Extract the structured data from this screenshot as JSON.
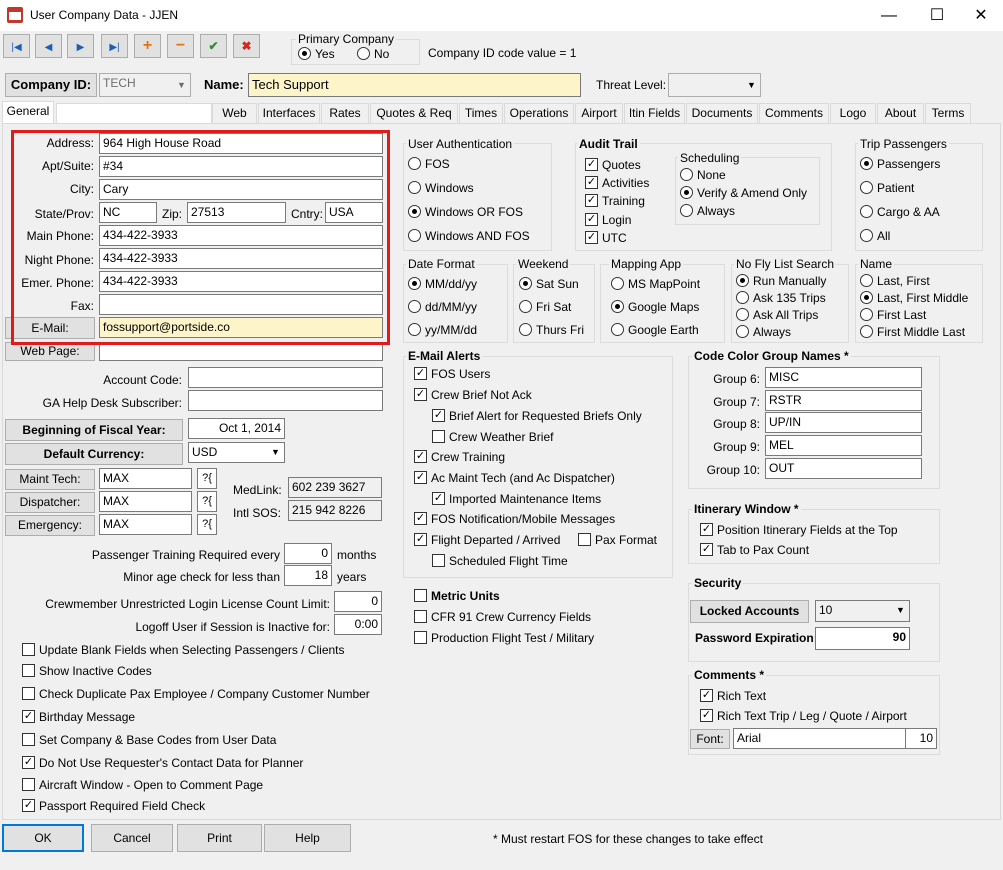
{
  "window": {
    "title": "User Company Data - JJEN",
    "minimize": "—",
    "maximize": "☐",
    "close": "✕"
  },
  "toolbar": {
    "first": "|◀",
    "prev": "◀",
    "next": "▶",
    "last": "▶|",
    "add": "+",
    "remove": "−",
    "confirm": "✔",
    "cancel": "✖"
  },
  "primary_company": {
    "title": "Primary Company",
    "yes": "Yes",
    "no": "No",
    "company_id_note": "Company ID code value = 1"
  },
  "header": {
    "company_id_label": "Company ID:",
    "company_id_value": "TECH",
    "name_label": "Name:",
    "name_value": "Tech Support",
    "threat_label": "Threat Level:",
    "threat_value": ""
  },
  "tabs": [
    "General",
    "",
    "Web",
    "Interfaces",
    "Rates",
    "Quotes & Req",
    "Times",
    "Operations",
    "Airport",
    "Itin Fields",
    "Documents",
    "Comments",
    "Logo",
    "About",
    "Terms"
  ],
  "address": {
    "address_label": "Address:",
    "address_value": "964 High House Road",
    "apt_label": "Apt/Suite:",
    "apt_value": "#34",
    "city_label": "City:",
    "city_value": "Cary",
    "state_label": "State/Prov:",
    "state_value": "NC",
    "zip_label": "Zip:",
    "zip_value": "27513",
    "country_label": "Cntry:",
    "country_value": "USA",
    "main_phone_label": "Main Phone:",
    "main_phone_value": "434-422-3933",
    "night_phone_label": "Night Phone:",
    "night_phone_value": "434-422-3933",
    "emer_phone_label": "Emer. Phone:",
    "emer_phone_value": "434-422-3933",
    "fax_label": "Fax:",
    "fax_value": "",
    "email_button": "E-Mail:",
    "email_value": "fossupport@portside.co",
    "webpage_button": "Web Page:",
    "webpage_value": ""
  },
  "misc": {
    "account_code_label": "Account Code:",
    "account_code_value": "",
    "ga_help_label": "GA Help Desk Subscriber:",
    "ga_help_value": "",
    "fiscal_button": "Beginning of Fiscal Year:",
    "fiscal_value": "Oct 1, 2014",
    "currency_button": "Default Currency:",
    "currency_value": "USD",
    "maint_tech_button": "Maint Tech:",
    "maint_tech_value": "MAX",
    "dispatcher_button": "Dispatcher:",
    "dispatcher_value": "MAX",
    "emergency_button": "Emergency:",
    "emergency_value": "MAX",
    "qm": "?{",
    "medlink_label": "MedLink:",
    "medlink_value": "602 239 3627",
    "intl_sos_label": "Intl SOS:",
    "intl_sos_value": "215 942 8226",
    "pax_training_label": "Passenger Training Required every",
    "pax_training_value": "0",
    "pax_training_unit": "months",
    "minor_age_label": "Minor age check for less than",
    "minor_age_value": "18",
    "minor_age_unit": "years",
    "license_label": "Crewmember Unrestricted Login License Count Limit:",
    "license_value": "0",
    "logoff_label": "Logoff User if Session is Inactive for:",
    "logoff_value": "0:00"
  },
  "left_checks": [
    {
      "label": "Update Blank Fields when Selecting Passengers / Clients",
      "checked": false
    },
    {
      "label": "Show Inactive Codes",
      "checked": false
    },
    {
      "label": "Check Duplicate Pax Employee / Company Customer Number",
      "checked": false
    },
    {
      "label": "Birthday Message",
      "checked": true
    },
    {
      "label": "Set Company & Base Codes from User Data",
      "checked": false
    },
    {
      "label": "Do Not Use Requester's Contact Data for Planner",
      "checked": true
    },
    {
      "label": "Aircraft Window - Open to Comment Page",
      "checked": false
    },
    {
      "label": "Passport Required Field Check",
      "checked": true
    }
  ],
  "user_auth": {
    "title": "User Authentication",
    "options": [
      "FOS",
      "Windows",
      "Windows OR FOS",
      "Windows AND FOS"
    ],
    "selected": 2
  },
  "audit_trail": {
    "title": "Audit Trail",
    "items": [
      {
        "label": "Quotes",
        "checked": true
      },
      {
        "label": "Activities",
        "checked": true
      },
      {
        "label": "Training",
        "checked": true
      },
      {
        "label": "Login",
        "checked": true
      },
      {
        "label": "UTC",
        "checked": true
      }
    ]
  },
  "scheduling": {
    "title": "Scheduling",
    "options": [
      "None",
      "Verify & Amend Only",
      "Always"
    ],
    "selected": 1
  },
  "trip_passengers": {
    "title": "Trip Passengers",
    "options": [
      "Passengers",
      "Patient",
      "Cargo & AA",
      "All"
    ],
    "selected": 0
  },
  "date_format": {
    "title": "Date Format",
    "options": [
      "MM/dd/yy",
      "dd/MM/yy",
      "yy/MM/dd"
    ],
    "selected": 0
  },
  "weekend": {
    "title": "Weekend",
    "options": [
      "Sat Sun",
      "Fri Sat",
      "Thurs Fri"
    ],
    "selected": 0
  },
  "mapping_app": {
    "title": "Mapping App",
    "options": [
      "MS MapPoint",
      "Google Maps",
      "Google Earth"
    ],
    "selected": 1
  },
  "no_fly": {
    "title": "No Fly List Search",
    "options": [
      "Run Manually",
      "Ask 135 Trips",
      "Ask All Trips",
      "Always"
    ],
    "selected": 0
  },
  "name_format": {
    "title": "Name",
    "options": [
      "Last, First",
      "Last, First Middle",
      "First Last",
      "First Middle Last"
    ],
    "selected": 1
  },
  "email_alerts": {
    "title": "E-Mail Alerts",
    "items": [
      {
        "label": "FOS Users",
        "checked": true
      },
      {
        "label": "Crew Brief Not Ack",
        "checked": true
      },
      {
        "label": "Brief Alert for Requested Briefs Only",
        "checked": true
      },
      {
        "label": "Crew Weather Brief",
        "checked": false
      },
      {
        "label": "Crew Training",
        "checked": true
      },
      {
        "label": "Ac Maint Tech (and Ac Dispatcher)",
        "checked": true
      },
      {
        "label": "Imported Maintenance Items",
        "checked": true
      },
      {
        "label": "FOS Notification/Mobile Messages",
        "checked": true
      },
      {
        "label": "Flight Departed / Arrived",
        "checked": true
      },
      {
        "label": "Pax Format",
        "checked": false
      },
      {
        "label": "Scheduled Flight Time",
        "checked": false
      }
    ]
  },
  "units": [
    {
      "label": "Metric Units",
      "checked": false
    },
    {
      "label": "CFR 91 Crew Currency Fields",
      "checked": false
    },
    {
      "label": "Production Flight Test / Military",
      "checked": false
    }
  ],
  "code_color": {
    "title": "Code Color Group Names *",
    "groups": [
      {
        "label": "Group 6:",
        "value": "MISC"
      },
      {
        "label": "Group 7:",
        "value": "RSTR"
      },
      {
        "label": "Group 8:",
        "value": "UP/IN"
      },
      {
        "label": "Group 9:",
        "value": "MEL"
      },
      {
        "label": "Group 10:",
        "value": "OUT"
      }
    ]
  },
  "itinerary": {
    "title": "Itinerary Window *",
    "items": [
      {
        "label": "Position Itinerary Fields at the Top",
        "checked": true
      },
      {
        "label": "Tab to Pax Count",
        "checked": true
      }
    ]
  },
  "security": {
    "title": "Security",
    "locked_button": "Locked Accounts",
    "locked_value": "10",
    "pwd_label": "Password Expiration:",
    "pwd_value": "90"
  },
  "comments": {
    "title": "Comments *",
    "items": [
      {
        "label": "Rich Text",
        "checked": true
      },
      {
        "label": "Rich Text Trip / Leg / Quote / Airport",
        "checked": true
      }
    ],
    "font_button": "Font:",
    "font_name": "Arial",
    "font_size": "10"
  },
  "footer": {
    "ok": "OK",
    "cancel": "Cancel",
    "print": "Print",
    "help": "Help",
    "note": "* Must restart FOS for these changes to take effect"
  }
}
